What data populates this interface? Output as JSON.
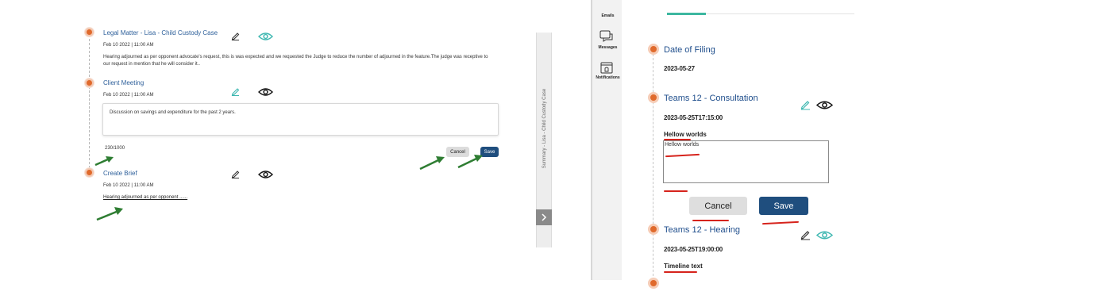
{
  "left_panel": {
    "items": [
      {
        "title": "Legal Matter - Lisa - Child Custody Case",
        "datetime": "Feb 10 2022 | 11:00 AM",
        "description": "Hearing adjourned as per opponent advocate's request, this is was expected and we requested the Judge to reduce the number of adjourned in the feature.The judge was receptive to our request in mention that he will consider it.."
      },
      {
        "title": "Client Meeting",
        "datetime": "Feb 10 2022 | 11:00 AM",
        "note_value": "Discussion on savings and expenditure for the past 2 years.",
        "char_count": "230/1000",
        "cancel_label": "Cancel",
        "save_label": "Save"
      },
      {
        "title": "Create Brief",
        "datetime": "Feb 10 2022 | 11:00 AM",
        "summary_link": "Hearing adjourned as per opponent ......"
      }
    ],
    "summary_panel": {
      "label": "Summary - Lisa - Child Custody Case",
      "expand_icon": "chevron-right-icon"
    }
  },
  "right_panel": {
    "sidebar": {
      "items": [
        {
          "label": "Emails",
          "icon": "email-icon"
        },
        {
          "label": "Messages",
          "icon": "messages-icon"
        },
        {
          "label": "Notifications",
          "icon": "notifications-icon"
        }
      ]
    },
    "timeline": [
      {
        "title": "Date of Filing",
        "date": "2023-05-27"
      },
      {
        "title": "Teams 12 - Consultation",
        "date": "2023-05-25T17:15:00",
        "note_label": "Hellow worlds",
        "note_value": "Hellow worlds",
        "cancel_label": "Cancel",
        "save_label": "Save"
      },
      {
        "title": "Teams 12 - Hearing",
        "date": "2023-05-25T19:00:00",
        "note_label": "Timeline text"
      }
    ]
  },
  "colors": {
    "accent_orange": "#e06a2c",
    "link_blue": "#2d5f9a",
    "save_button": "#1f4e7e",
    "teal_eye": "#3db7b0",
    "annotation_green": "#2e7d32",
    "annotation_red": "#d6231c"
  }
}
